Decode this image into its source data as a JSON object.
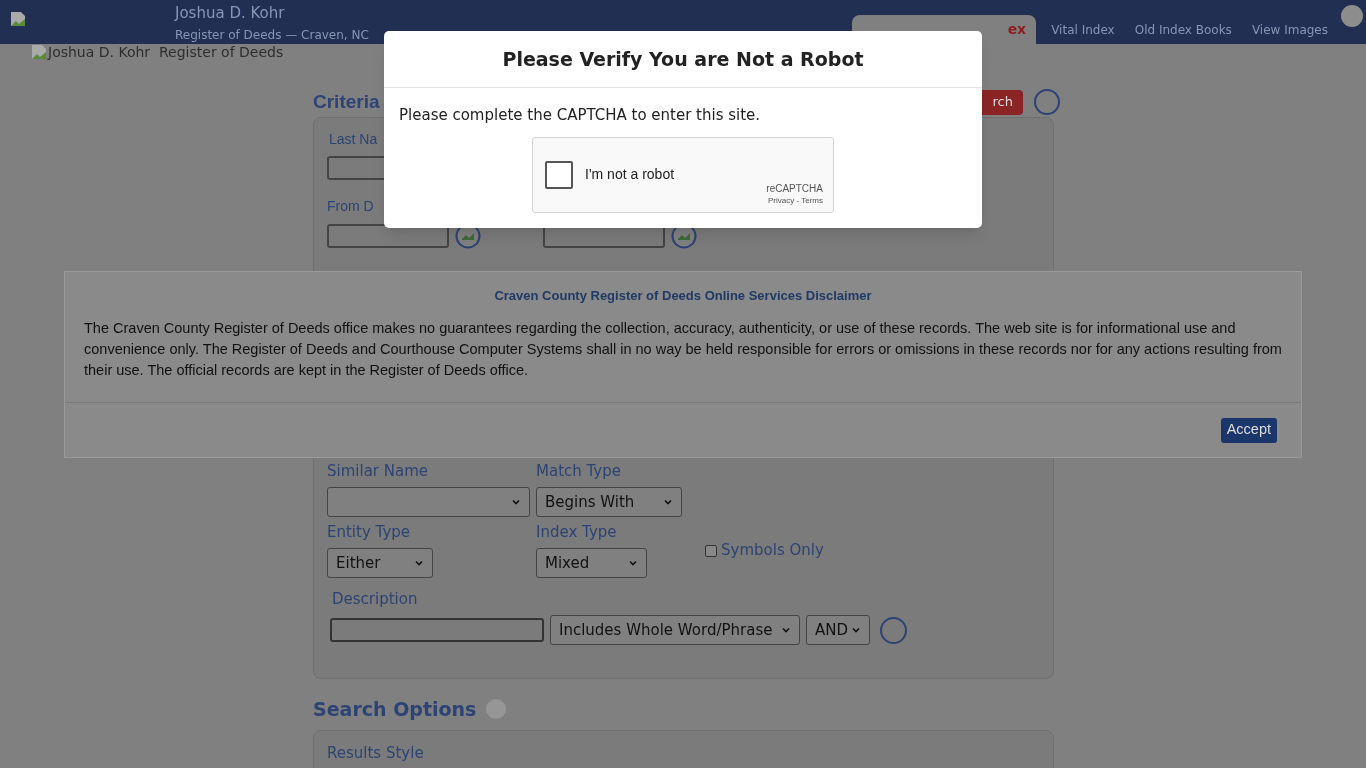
{
  "header": {
    "title": "Joshua D. Kohr",
    "subtitle": "Register of Deeds — Craven, NC",
    "logo_alt": "Joshua D. Kohr  Register of Deeds",
    "tabs": [
      {
        "label": "ex",
        "selected": true
      },
      {
        "label": "Vital Index",
        "selected": false
      },
      {
        "label": "Old Index Books",
        "selected": false
      },
      {
        "label": "View Images",
        "selected": false
      }
    ]
  },
  "criteria": {
    "heading": "Criteria",
    "search_button": "rch",
    "fields_top": [
      {
        "label": "Last Na"
      },
      {
        "label": "From D"
      }
    ],
    "similar_name": {
      "label": "Similar Name"
    },
    "match_type": {
      "label": "Match Type",
      "value": "Begins With"
    },
    "entity_type": {
      "label": "Entity Type",
      "value": "Either"
    },
    "index_type": {
      "label": "Index Type",
      "value": "Mixed"
    },
    "symbols_only": {
      "label": "Symbols Only",
      "checked": false
    },
    "description": {
      "label": "Description",
      "mode": "Includes Whole Word/Phrase",
      "operator": "AND"
    }
  },
  "search_options": {
    "heading": "Search Options",
    "results_style_label": "Results Style"
  },
  "disclaimer": {
    "title": "Craven County Register of Deeds Online Services Disclaimer",
    "text": "The Craven County Register of Deeds office makes no guarantees regarding the collection, accuracy, authenticity, or use of these records. The web site is for informational use and convenience only. The Register of Deeds and Courthouse Computer Systems shall in no way be held responsible for errors or omissions in these records nor for any actions resulting from their use. The official records are kept in the Register of Deeds office.",
    "button": "Accept"
  },
  "modal": {
    "title": "Please Verify You are Not a Robot",
    "text": "Please complete the CAPTCHA to enter this site.",
    "captcha": {
      "label": "I'm not a robot",
      "checked": false,
      "brand": "reCAPTCHA",
      "links": "Privacy - Terms"
    }
  }
}
